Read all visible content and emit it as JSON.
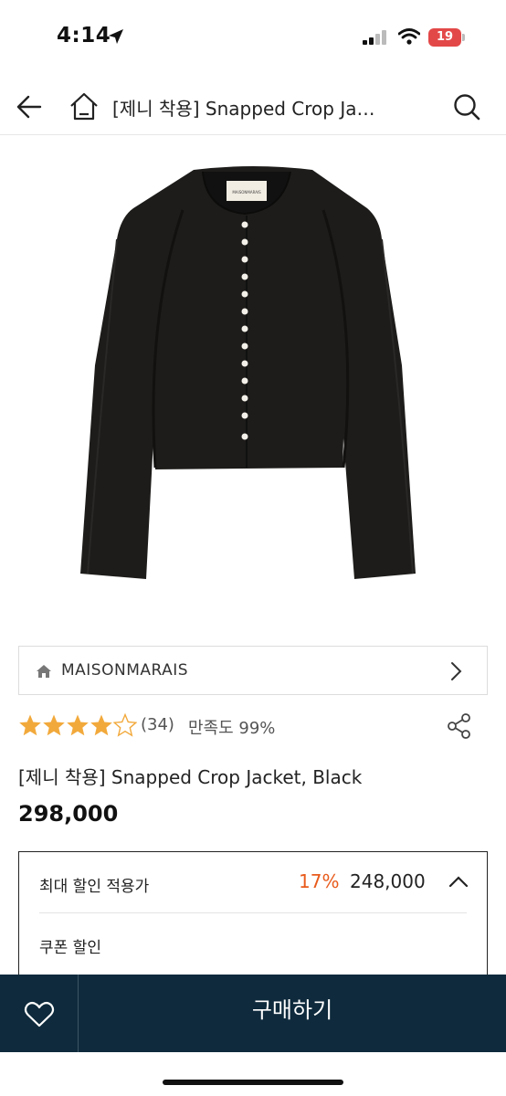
{
  "status_bar": {
    "time": "4:14",
    "battery": "19"
  },
  "header": {
    "title": "[제니 착용] Snapped Crop Ja…",
    "icons": [
      "back-arrow-icon",
      "home-icon",
      "search-icon"
    ]
  },
  "product_image": {
    "label_text": "MAISONMARAIS",
    "description_icon": "jacket-photo"
  },
  "brand": {
    "name": "MAISONMARAIS"
  },
  "rating": {
    "stars": 4.5,
    "review_count": "(34)",
    "satisfaction": "만족도 99%"
  },
  "product": {
    "name": "[제니 착용] Snapped Crop Jacket, Black",
    "price": "298,000"
  },
  "discount": {
    "label": "최대 할인 적용가",
    "rate": "17%",
    "price": "248,000",
    "coupon_label": "쿠폰 할인"
  },
  "bottom_bar": {
    "buy_label": "구매하기"
  },
  "colors": {
    "accent_orange": "#e85b1c",
    "star_color": "#f2a93b",
    "bottom_bar": "#0e2a3c"
  }
}
